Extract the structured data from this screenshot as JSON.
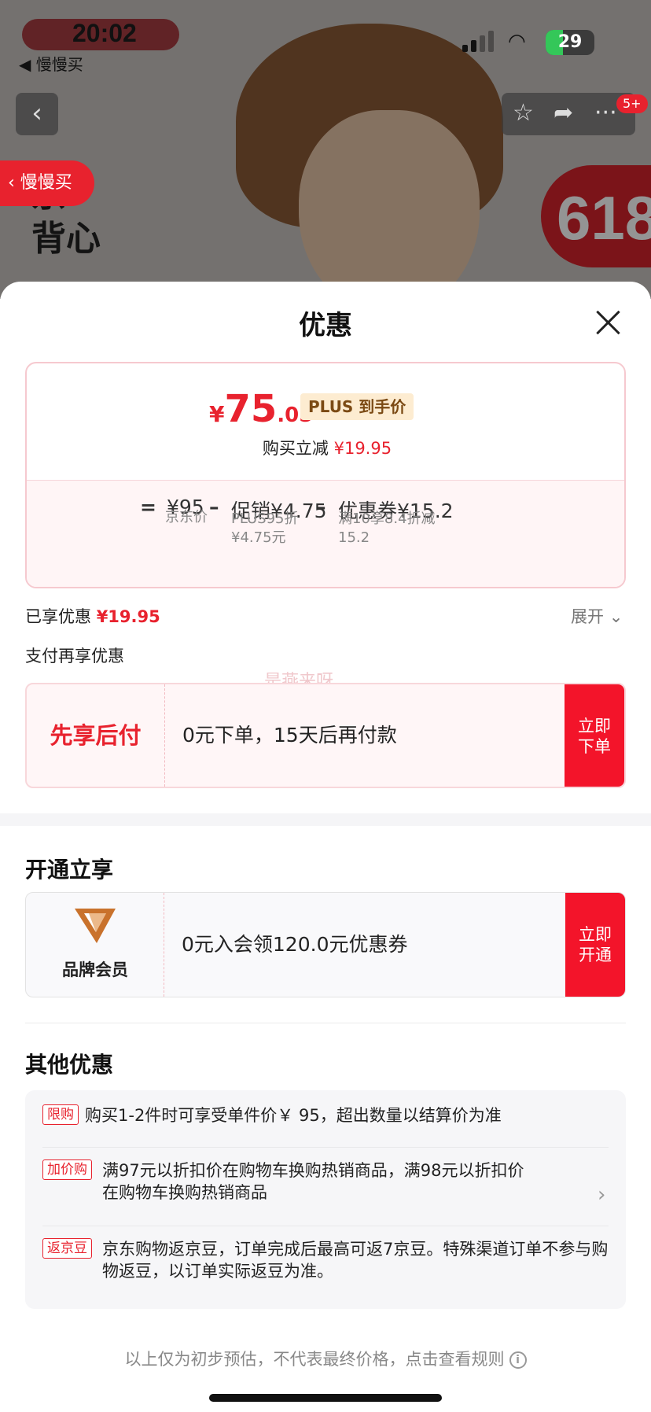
{
  "status_bar": {
    "time": "20:02",
    "back_app": "◀ 慢慢买",
    "battery": "29"
  },
  "background": {
    "slow_buy_pill": "慢慢买",
    "product_text_line1": "京",
    "product_text_line2": "背心",
    "badge_618": "618",
    "notification_badge": "5+"
  },
  "sheet": {
    "title": "优惠"
  },
  "price_card": {
    "currency": "¥",
    "price_int": "75",
    "price_dec": ".05",
    "plus_tag": "PLUS 到手价",
    "reduce_label": "购买立减",
    "reduce_value": "¥19.95",
    "formula": {
      "equals": "=",
      "base": "¥95",
      "base_label": "京东价",
      "minus1": "–",
      "promo": "促销¥4.75",
      "promo_label_1": "PLUS95折",
      "promo_label_2": "¥4.75元",
      "minus2": "–",
      "coupon": "优惠券¥15.2",
      "coupon_label_1": "满10享8.4折减",
      "coupon_label_2": "15.2"
    }
  },
  "enjoyed": {
    "label": "已享优惠",
    "value": "¥19.95",
    "expand": "展开"
  },
  "pay_more": {
    "label": "支付再享优惠",
    "watermark": "是燕来呀",
    "pay_later_title": "先享后付",
    "pay_later_text": "0元下单，15天后再付款",
    "pay_later_button_1": "立即",
    "pay_later_button_2": "下单"
  },
  "open_enjoy": {
    "heading": "开通立享",
    "member_label": "品牌会员",
    "member_text": "0元入会领120.0元优惠券",
    "member_button_1": "立即",
    "member_button_2": "开通"
  },
  "other": {
    "heading": "其他优惠",
    "items": [
      {
        "tag": "限购",
        "text": "购买1-2件时可享受单件价￥ 95，超出数量以结算价为准"
      },
      {
        "tag": "加价购",
        "text": "满97元以折扣价在购物车换购热销商品，满98元以折扣价在购物车换购热销商品"
      },
      {
        "tag": "返京豆",
        "text": "京东购物返京豆，订单完成后最高可返7京豆。特殊渠道订单不参与购物返豆，以订单实际返豆为准。"
      }
    ]
  },
  "footer": {
    "text": "以上仅为初步预估，不代表最终价格，点击查看规则"
  },
  "colors": {
    "accent_red": "#e8222e",
    "button_red": "#f3142a",
    "plus_tag_bg": "#fdecd1"
  }
}
